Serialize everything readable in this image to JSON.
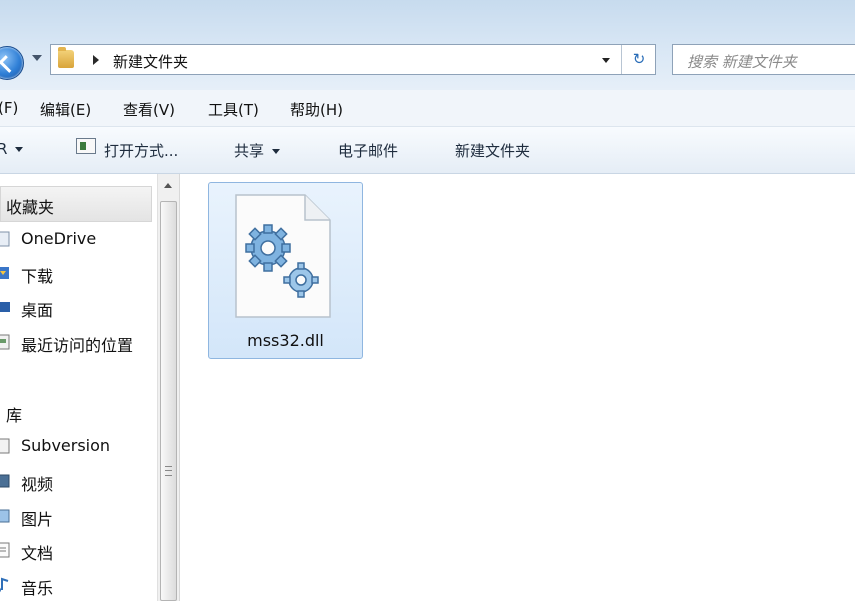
{
  "address_bar": {
    "breadcrumb": "新建文件夹",
    "search_placeholder": "搜索 新建文件夹",
    "refresh_icon": "↻"
  },
  "menu": {
    "items": [
      "(F)",
      "编辑(E)",
      "查看(V)",
      "工具(T)",
      "帮助(H)"
    ]
  },
  "commands": {
    "organize_fragment": "R",
    "open_with": "打开方式...",
    "share": "共享",
    "email": "电子邮件",
    "new_folder": "新建文件夹"
  },
  "nav_pane": {
    "favorites_header": "收藏夹",
    "favorites": [
      "OneDrive",
      "下载",
      "桌面",
      "最近访问的位置"
    ],
    "libraries_header": "库",
    "libraries": [
      "Subversion",
      "视频",
      "图片",
      "文档",
      "音乐"
    ]
  },
  "files": [
    {
      "name": "mss32.dll",
      "icon": "dll-gear-icon",
      "selected": true
    }
  ],
  "colors": {
    "selection_fill": "#d3e6f9",
    "selection_border": "#8fb6e0",
    "chrome_blue": "#c7dbee"
  }
}
